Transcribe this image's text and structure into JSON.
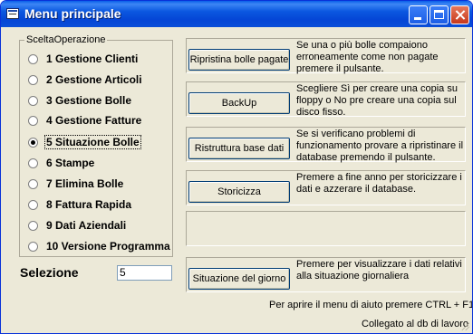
{
  "window": {
    "title": "Menu principale"
  },
  "options_group": {
    "label": "SceltaOperazione",
    "items": [
      {
        "label": "1 Gestione Clienti",
        "selected": false
      },
      {
        "label": "2 Gestione Articoli",
        "selected": false
      },
      {
        "label": "3 Gestione Bolle",
        "selected": false
      },
      {
        "label": "4 Gestione Fatture",
        "selected": false
      },
      {
        "label": "5 Situazione Bolle",
        "selected": true
      },
      {
        "label": "6 Stampe",
        "selected": false
      },
      {
        "label": "7 Elimina Bolle",
        "selected": false
      },
      {
        "label": "8 Fattura Rapida",
        "selected": false
      },
      {
        "label": "9 Dati Aziendali",
        "selected": false
      },
      {
        "label": "10 Versione Programma",
        "selected": false
      }
    ]
  },
  "selection": {
    "label": "Selezione",
    "value": "5"
  },
  "actions": [
    {
      "button": "Ripristina bolle pagate",
      "description": "Se una o più bolle compaiono erroneamente come non pagate premere il pulsante."
    },
    {
      "button": "BackUp",
      "description": "Scegliere Sì per creare una copia su floppy o No pre creare una copia sul disco fisso."
    },
    {
      "button": "Ristruttura base dati",
      "description": "Se si verificano problemi di funzionamento provare a ripristinare il database premendo il pulsante."
    },
    {
      "button": "Storicizza",
      "description": "Premere a fine anno per storicizzare i dati e azzerare il database."
    },
    {
      "button": "",
      "description": ""
    },
    {
      "button": "Situazione del giorno",
      "description": "Premere per visualizzare i dati relativi alla situazione giornaliera"
    }
  ],
  "footer": {
    "help": "Per aprire il menu di aiuto premere CTRL + F1",
    "status": "Collegato al db di lavoro"
  }
}
